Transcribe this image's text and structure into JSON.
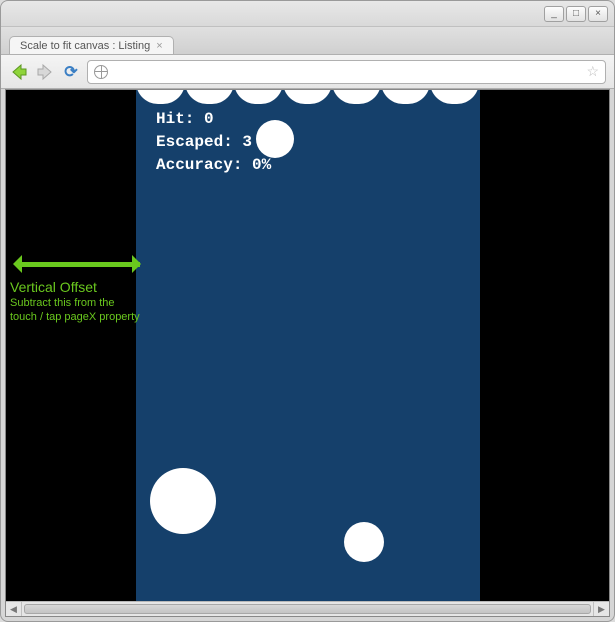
{
  "window": {
    "controls": {
      "min": "_",
      "max": "□",
      "close": "×"
    }
  },
  "tab": {
    "title": "Scale to fit canvas : Listing",
    "close_glyph": "×"
  },
  "toolbar": {
    "back_glyph": "⬅",
    "forward_glyph": "➡",
    "reload_glyph": "⟳",
    "url_value": "",
    "star_glyph": "☆"
  },
  "annotation": {
    "title": "Vertical Offset",
    "subtitle": "Subtract this from the touch / tap pageX property"
  },
  "game": {
    "stats": {
      "hit_label": "Hit:",
      "hit_value": "0",
      "escaped_label": "Escaped:",
      "escaped_value": "3",
      "accuracy_label": "Accuracy:",
      "accuracy_value": "0%"
    }
  },
  "chart_data": {
    "type": "table",
    "title": "Game score overlay",
    "rows": [
      {
        "metric": "Hit",
        "value": 0
      },
      {
        "metric": "Escaped",
        "value": 3
      },
      {
        "metric": "Accuracy",
        "value": "0%"
      }
    ]
  }
}
